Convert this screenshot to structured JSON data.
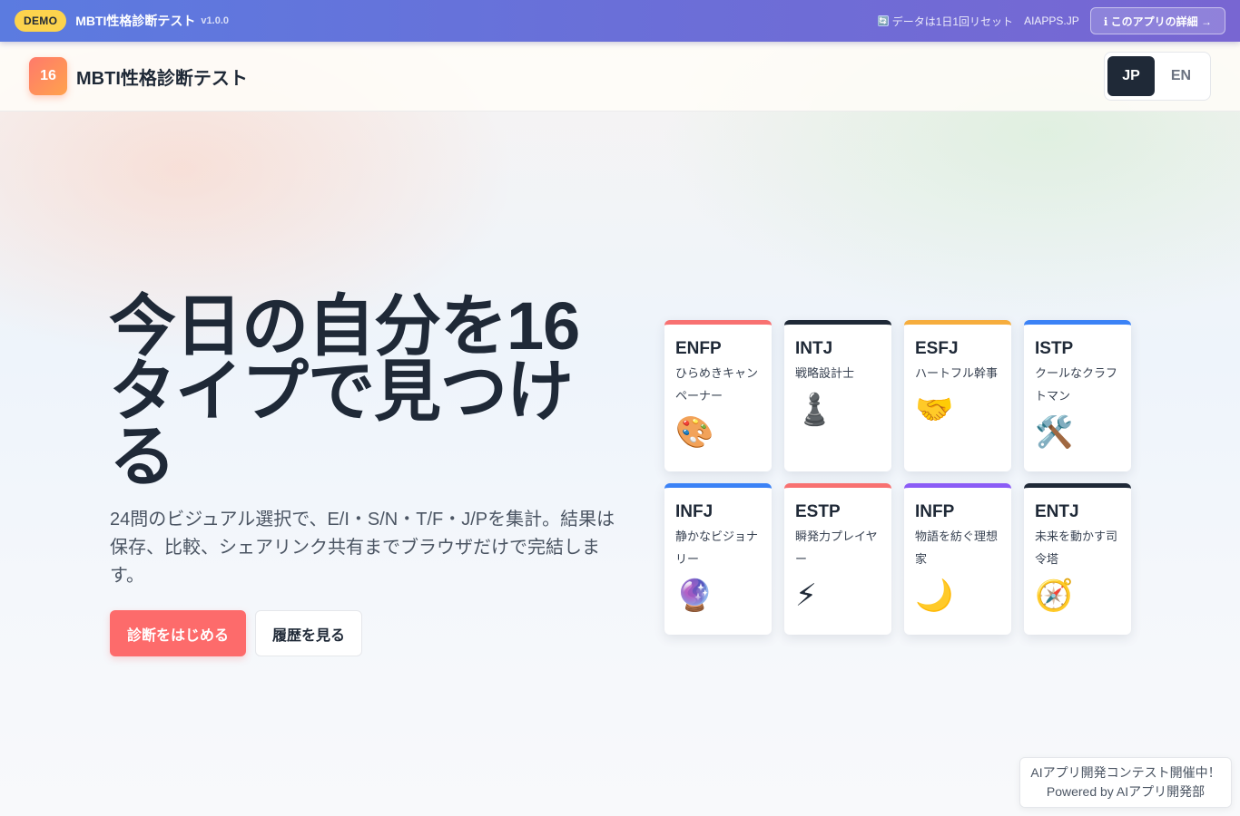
{
  "demo_bar": {
    "badge": "DEMO",
    "title": "MBTI性格診断テスト",
    "version": "v1.0.0",
    "reset_icon": "🔄",
    "reset_text": "データは1日1回リセット",
    "site_link": "AIAPPS.JP",
    "details_label": "ℹ このアプリの詳細 →"
  },
  "header": {
    "logo_text": "16",
    "title": "MBTI性格診断テスト",
    "languages": [
      {
        "label": "JP",
        "active": true
      },
      {
        "label": "EN",
        "active": false
      }
    ]
  },
  "hero": {
    "title": "今日の自分を16タイプで見つける",
    "description": "24問のビジュアル選択で、E/I・S/N・T/F・J/Pを集計。結果は保存、比較、シェアリンク共有までブラウザだけで完結します。",
    "start_button": "診断をはじめる",
    "history_button": "履歴を見る"
  },
  "cards": [
    {
      "code": "ENFP",
      "name": "ひらめきキャンペーナー",
      "emoji": "🎨",
      "icon": "palette-icon",
      "color": "#f87171"
    },
    {
      "code": "INTJ",
      "name": "戦略設計士",
      "emoji": "♟️",
      "icon": "chess-pawn-icon",
      "color": "#1f2937"
    },
    {
      "code": "ESFJ",
      "name": "ハートフル幹事",
      "emoji": "🤝",
      "icon": "handshake-icon",
      "color": "#f6ad3d"
    },
    {
      "code": "ISTP",
      "name": "クールなクラフトマン",
      "emoji": "🛠️",
      "icon": "tools-icon",
      "color": "#3b82f6"
    },
    {
      "code": "INFJ",
      "name": "静かなビジョナリー",
      "emoji": "🔮",
      "icon": "crystal-ball-icon",
      "color": "#3b82f6"
    },
    {
      "code": "ESTP",
      "name": "瞬発力プレイヤー",
      "emoji": "⚡",
      "icon": "lightning-icon",
      "color": "#f87171"
    },
    {
      "code": "INFP",
      "name": "物語を紡ぐ理想家",
      "emoji": "🌙",
      "icon": "moon-icon",
      "color": "#8b5cf6"
    },
    {
      "code": "ENTJ",
      "name": "未来を動かす司令塔",
      "emoji": "🧭",
      "icon": "compass-icon",
      "color": "#1f2937"
    }
  ],
  "footer": {
    "line1": "AIアプリ開発コンテスト開催中！",
    "line2": "Powered by AIアプリ開発部"
  }
}
